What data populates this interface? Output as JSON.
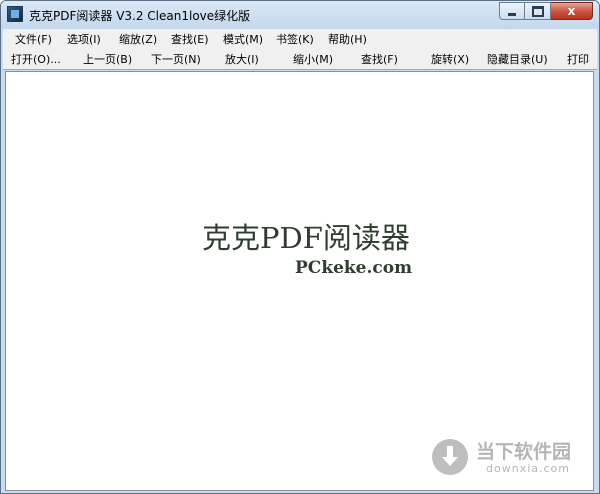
{
  "window": {
    "title": "克克PDF阅读器 V3.2 Clean1love绿化版",
    "controls": {
      "close_glyph": "x"
    }
  },
  "menubar": {
    "items": [
      {
        "label": "文件(F)"
      },
      {
        "label": "选项(I)"
      },
      {
        "label": "缩放(Z)"
      },
      {
        "label": "查找(E)"
      },
      {
        "label": "模式(M)"
      },
      {
        "label": "书签(K)"
      },
      {
        "label": "帮助(H)"
      }
    ]
  },
  "toolbar": {
    "buttons": [
      {
        "label": "打开(O)..."
      },
      {
        "label": "上一页(B)"
      },
      {
        "label": "下一页(N)"
      },
      {
        "label": "放大(I)"
      },
      {
        "label": "缩小(M)"
      },
      {
        "label": "查找(F)"
      },
      {
        "label": "旋转(X)"
      },
      {
        "label": "隐藏目录(U)"
      },
      {
        "label": "打印"
      }
    ]
  },
  "content": {
    "splash_title": "克克PDF阅读器",
    "splash_url": "PCkeke.com"
  },
  "watermark": {
    "name": "当下软件园",
    "domain": "downxia.com",
    "icon": "download-arrow-icon"
  }
}
